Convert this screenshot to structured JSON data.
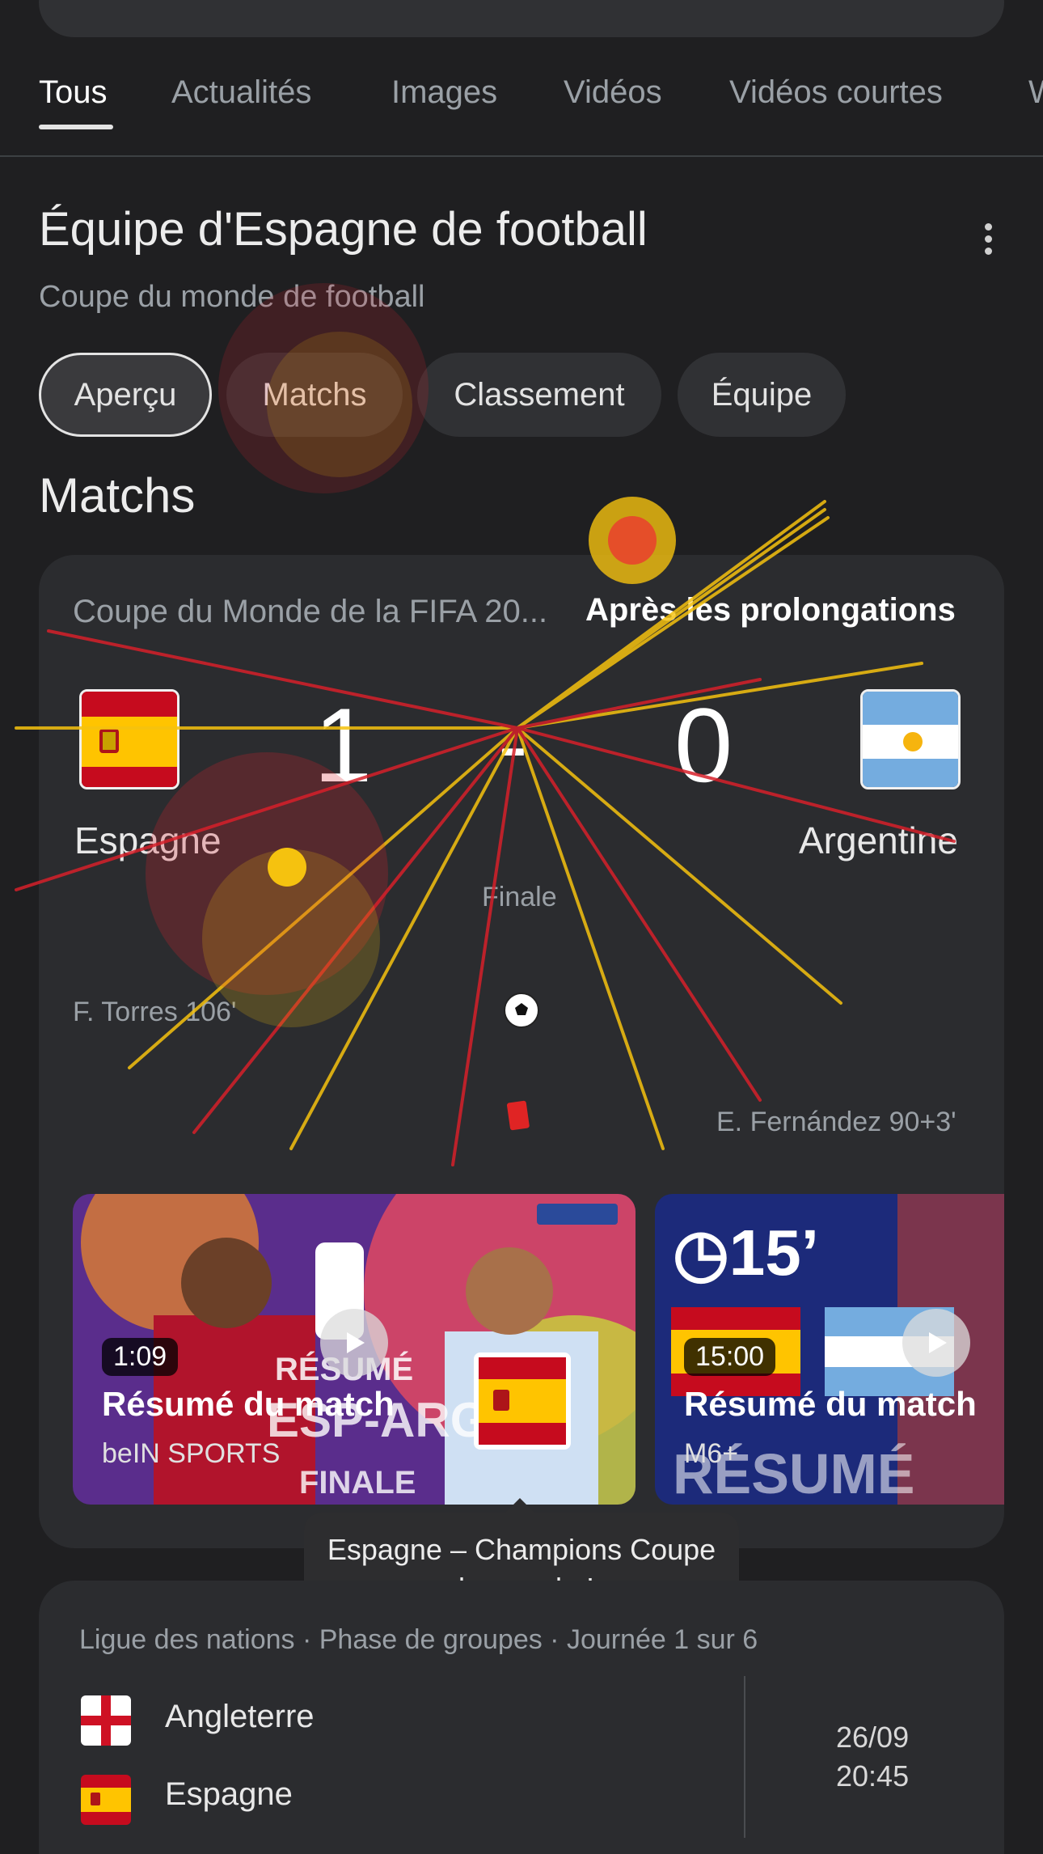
{
  "tabs": [
    "Tous",
    "Actualités",
    "Images",
    "Vidéos",
    "Vidéos courtes",
    "W"
  ],
  "entity": {
    "title": "Équipe d'Espagne de football",
    "subtitle": "Coupe du monde de football"
  },
  "chips": [
    "Aperçu",
    "Matchs",
    "Classement",
    "Équipe"
  ],
  "section_title": "Matchs",
  "match": {
    "competition": "Coupe du Monde de la FIFA 20...",
    "status": "Après les prolongations",
    "home": {
      "name": "Espagne",
      "score": "1"
    },
    "separator": "-",
    "away": {
      "name": "Argentine",
      "score": "0"
    },
    "stage": "Finale",
    "home_scorer": "F. Torres 106'",
    "away_event": "E. Fernández 90+3'"
  },
  "videos": [
    {
      "duration": "1:09",
      "title": "Résumé du match",
      "source": "beIN SPORTS",
      "thumb_text": "RÉSUMÉ ESP - ARG FINALE"
    },
    {
      "duration": "15:00",
      "title": "Résumé du match",
      "source": "M6+",
      "thumb_text": "15’",
      "thumb_text2": "RÉSUMÉ"
    }
  ],
  "tooltip": "Espagne – Champions Coupe du monde !",
  "upcoming": {
    "league": "Ligue des nations · Phase de groupes · Journée 1 sur 6",
    "team1": "Angleterre",
    "team2": "Espagne",
    "date": "26/09",
    "time": "20:45"
  },
  "colors": {
    "background": "#1f1f21",
    "card": "#2b2c2f",
    "spain_red": "#c60b1e",
    "spain_yellow": "#ffc400",
    "argentina_blue": "#74acdf"
  }
}
